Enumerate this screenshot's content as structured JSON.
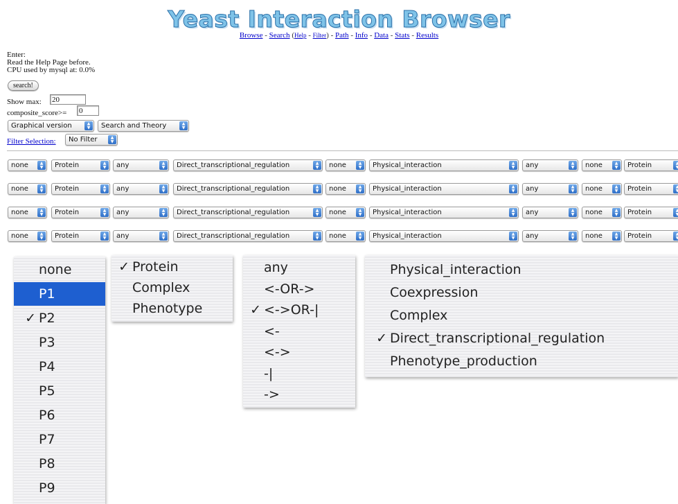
{
  "header": {
    "title": "Yeast Interaction Browser",
    "nav": {
      "browse": "Browse",
      "sep1": "-",
      "search": "Search",
      "paren_open": "(",
      "help": "Help",
      "sep2": "-",
      "filter": "Filter",
      "paren_close": ")",
      "sep3": "-",
      "path": "Path",
      "sep4": "-",
      "info": "Info",
      "sep5": "-",
      "data": "Data",
      "sep6": "-",
      "stats": "Stats",
      "sep7": "-",
      "results": "Results"
    }
  },
  "form": {
    "enter": "Enter:",
    "help_note": "Read the Help Page before.",
    "cpu": "CPU used by mysql at: 0.0%",
    "search_button": "search!",
    "show_max_label": "Show max:",
    "show_max_value": "20",
    "composite_label": "composite_score>=",
    "composite_value": "0",
    "version_select": "Graphical version",
    "mode_select": "Search and Theory",
    "filter_link": "Filter Selection:",
    "filter_select": "No Filter"
  },
  "rows": [
    [
      "none",
      "Protein",
      "any",
      "Direct_transcriptional_regulation",
      "none",
      "Physical_interaction",
      "any",
      "none",
      "Protein"
    ],
    [
      "none",
      "Protein",
      "any",
      "Direct_transcriptional_regulation",
      "none",
      "Physical_interaction",
      "any",
      "none",
      "Protein"
    ],
    [
      "none",
      "Protein",
      "any",
      "Direct_transcriptional_regulation",
      "none",
      "Physical_interaction",
      "any",
      "none",
      "Protein"
    ],
    [
      "none",
      "Protein",
      "any",
      "Direct_transcriptional_regulation",
      "none",
      "Physical_interaction",
      "any",
      "none",
      "Protein"
    ]
  ],
  "menus": {
    "p_menu": {
      "items": [
        "none",
        "P1",
        "P2",
        "P3",
        "P4",
        "P5",
        "P6",
        "P7",
        "P8",
        "P9"
      ],
      "highlighted": "P1",
      "checked": "P2"
    },
    "type_menu": {
      "items": [
        "Protein",
        "Complex",
        "Phenotype"
      ],
      "checked": "Protein"
    },
    "direction_menu": {
      "items": [
        "any",
        "<-OR->",
        "<->OR-|",
        "<-",
        "<->",
        "-|",
        "->"
      ],
      "checked": "<->OR-|"
    },
    "interaction_menu": {
      "items": [
        "Physical_interaction",
        "Coexpression",
        "Complex",
        "Direct_transcriptional_regulation",
        "Phenotype_production"
      ],
      "checked": "Direct_transcriptional_regulation"
    },
    "check_mark": "✓"
  },
  "colors": {
    "title_fill": "#7fc3e8",
    "title_stroke": "#2a6fa8",
    "link": "#0000cc",
    "menu_highlight": "#1e5fd0",
    "select_arrow": "#2f6fc8"
  }
}
